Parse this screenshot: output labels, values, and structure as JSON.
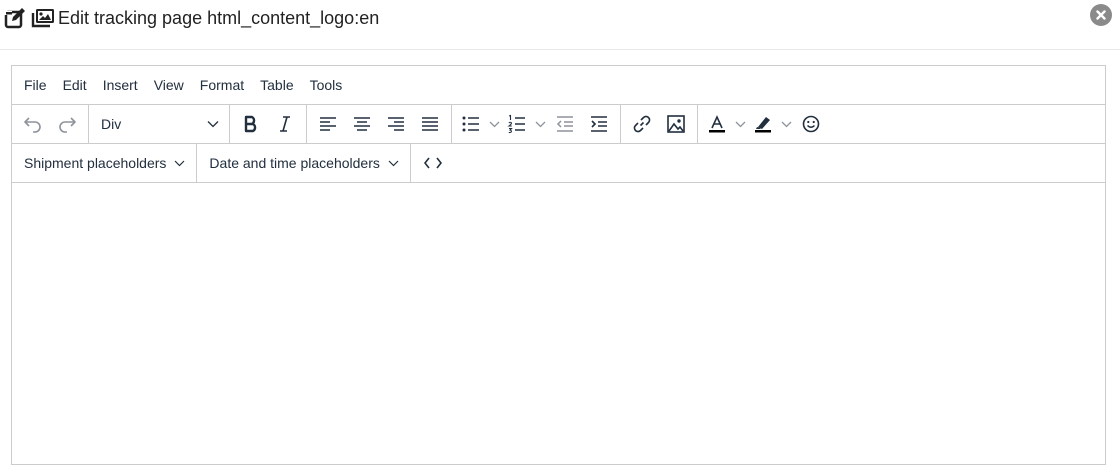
{
  "dialog": {
    "title": "Edit tracking page html_content_logo:en",
    "icons": [
      "edit-icon",
      "images-icon"
    ],
    "close_icon": "close-icon"
  },
  "menubar": {
    "items": [
      "File",
      "Edit",
      "Insert",
      "View",
      "Format",
      "Table",
      "Tools"
    ]
  },
  "toolbar": {
    "block_format": "Div",
    "icons": [
      "undo-icon",
      "redo-icon",
      "bold-icon",
      "italic-icon",
      "align-left-icon",
      "align-center-icon",
      "align-right-icon",
      "align-justify-icon",
      "bullet-list-icon",
      "numbered-list-icon",
      "outdent-icon",
      "indent-icon",
      "link-icon",
      "image-icon",
      "text-color-icon",
      "highlight-color-icon",
      "emoji-icon"
    ]
  },
  "toolbar2": {
    "shipment_placeholders": "Shipment placeholders",
    "datetime_placeholders": "Date and time placeholders",
    "code_icon": "code-icon"
  },
  "colors": {
    "text": "#222f3e",
    "border": "#cccccc",
    "close_bg": "#8a8a8a"
  }
}
